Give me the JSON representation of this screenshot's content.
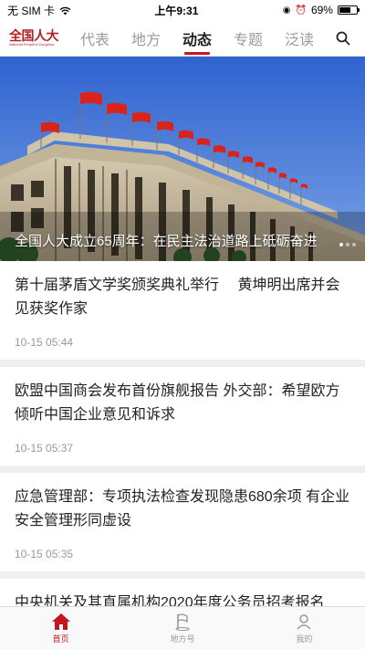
{
  "status_bar": {
    "carrier": "无 SIM 卡",
    "time": "上午9:31",
    "battery": "69%",
    "battery_level": 0.69
  },
  "header": {
    "logo_main": "全国人大",
    "logo_sub": "National People's Congress",
    "tabs": [
      {
        "label": "代表",
        "active": false
      },
      {
        "label": "地方",
        "active": false
      },
      {
        "label": "动态",
        "active": true
      },
      {
        "label": "专题",
        "active": false
      },
      {
        "label": "泛读",
        "active": false
      }
    ],
    "search_icon": "search-icon"
  },
  "hero": {
    "caption": "全国人大成立65周年：在民主法治道路上砥砺奋进",
    "slides": 3,
    "active_slide": 0
  },
  "news": [
    {
      "title": "第十届茅盾文学奖颁奖典礼举行　 黄坤明出席并会见获奖作家",
      "time": "10-15 05:44"
    },
    {
      "title": "欧盟中国商会发布首份旗舰报告 外交部：希望欧方倾听中国企业意见和诉求",
      "time": "10-15 05:37"
    },
    {
      "title": "应急管理部：专项执法检查发现隐患680余项 有企业安全管理形同虚设",
      "time": "10-15 05:35"
    },
    {
      "title": "中央机关及其直属机构2020年度公务员招考报名",
      "time": ""
    }
  ],
  "tabbar": [
    {
      "label": "首页",
      "icon": "home-icon",
      "active": true
    },
    {
      "label": "地方号",
      "icon": "flag-icon",
      "active": false
    },
    {
      "label": "我的",
      "icon": "user-icon",
      "active": false
    }
  ],
  "colors": {
    "accent": "#c4161c",
    "sky": "#3a6fd6"
  }
}
